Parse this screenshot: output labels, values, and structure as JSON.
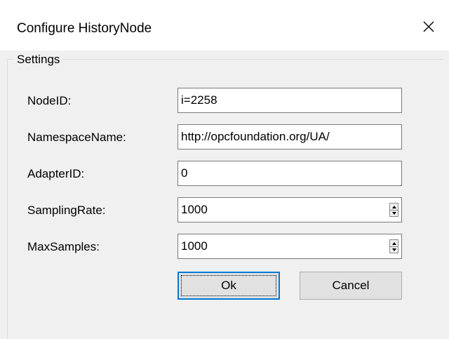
{
  "window": {
    "title": "Configure HistoryNode",
    "close_icon": "close-icon"
  },
  "settings": {
    "group_label": "Settings",
    "fields": [
      {
        "label": "NodeID:",
        "value": "i=2258"
      },
      {
        "label": "NamespaceName:",
        "value": "http://opcfoundation.org/UA/"
      },
      {
        "label": "AdapterID:",
        "value": "0"
      },
      {
        "label": "SamplingRate:",
        "value": "1000"
      },
      {
        "label": "MaxSamples:",
        "value": "1000"
      }
    ]
  },
  "buttons": {
    "ok_label": "Ok",
    "cancel_label": "Cancel"
  },
  "colors": {
    "background": "#f0f0f0",
    "accent": "#0078d7"
  }
}
